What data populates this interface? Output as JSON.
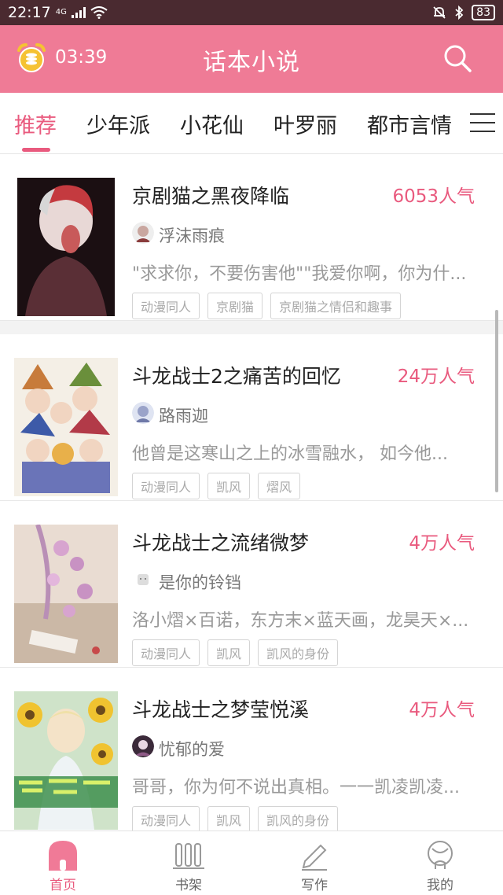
{
  "status_bar": {
    "time": "22:17",
    "network": "4G",
    "battery": "83"
  },
  "header": {
    "timer": "03:39",
    "title": "话本小说"
  },
  "tabs": [
    {
      "label": "推荐",
      "active": true
    },
    {
      "label": "少年派",
      "active": false
    },
    {
      "label": "小花仙",
      "active": false
    },
    {
      "label": "叶罗丽",
      "active": false
    },
    {
      "label": "都市言情",
      "active": false
    }
  ],
  "books": [
    {
      "title": "京剧猫之黑夜降临",
      "popularity": "6053人气",
      "author": "浮沫雨痕",
      "summary": "\"求求你，不要伤害他\"\"我爱你啊，你为什...",
      "tags": [
        "动漫同人",
        "京剧猫",
        "京剧猫之情侣和趣事"
      ]
    },
    {
      "title": "斗龙战士2之痛苦的回忆",
      "popularity": "24万人气",
      "author": "路雨迦",
      "summary": "他曾是这寒山之上的冰雪融水， 如今他...",
      "tags": [
        "动漫同人",
        "凯风",
        "熠风"
      ]
    },
    {
      "title": "斗龙战士之流绪微梦",
      "popularity": "4万人气",
      "author": "是你的铃铛",
      "summary": "洛小熠×百诺，东方末×蓝天画，龙昊天×...",
      "tags": [
        "动漫同人",
        "凯风",
        "凯风的身份"
      ]
    },
    {
      "title": "斗龙战士之梦莹悦溪",
      "popularity": "4万人气",
      "author": "忧郁的爱",
      "summary": "哥哥，你为何不说出真相。一一凯凌凯凌...",
      "tags": [
        "动漫同人",
        "凯风",
        "凯风的身份"
      ]
    }
  ],
  "bottom_nav": [
    {
      "label": "首页",
      "icon": "home-icon",
      "active": true
    },
    {
      "label": "书架",
      "icon": "bookshelf-icon",
      "active": false
    },
    {
      "label": "写作",
      "icon": "pen-icon",
      "active": false
    },
    {
      "label": "我的",
      "icon": "profile-icon",
      "active": false
    }
  ],
  "colors": {
    "accent": "#ef7b96",
    "active_text": "#e95a7e",
    "status_bar": "#4a2a30"
  }
}
